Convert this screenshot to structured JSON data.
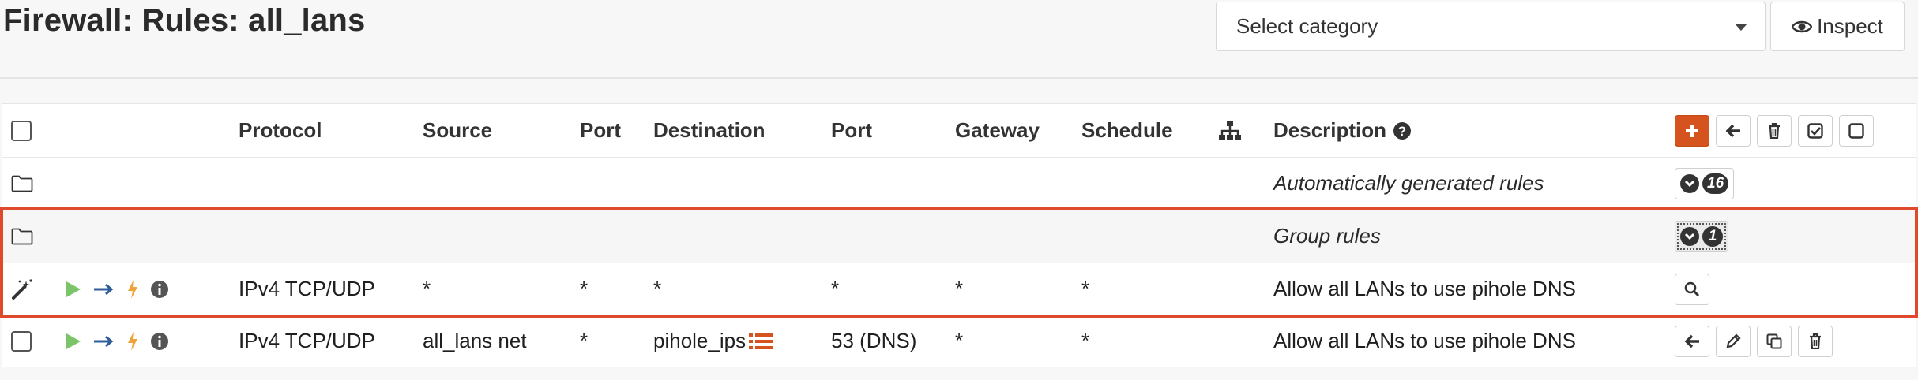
{
  "page": {
    "title": "Firewall: Rules: all_lans"
  },
  "toolbar": {
    "category_placeholder": "Select category",
    "inspect_label": "Inspect"
  },
  "table": {
    "headers": {
      "protocol": "Protocol",
      "source": "Source",
      "port": "Port",
      "destination": "Destination",
      "dest_port": "Port",
      "gateway": "Gateway",
      "schedule": "Schedule",
      "description": "Description"
    },
    "groups": [
      {
        "label": "Automatically generated rules",
        "count": "16"
      },
      {
        "label": "Group rules",
        "count": "1"
      }
    ],
    "rules": [
      {
        "protocol": "IPv4 TCP/UDP",
        "source": "*",
        "port": "*",
        "destination": "*",
        "dest_port": "*",
        "gateway": "*",
        "schedule": "*",
        "description": "Allow all LANs to use pihole DNS"
      },
      {
        "protocol": "IPv4 TCP/UDP",
        "source": "all_lans net",
        "port": "*",
        "destination": "pihole_ips",
        "dest_port": "53 (DNS)",
        "gateway": "*",
        "schedule": "*",
        "description": "Allow all LANs to use pihole DNS"
      }
    ]
  },
  "colors": {
    "accent": "#d4531f",
    "highlight": "#e04a2c",
    "play": "#7cc46a",
    "arrow": "#2f5d9a",
    "bolt": "#f0a23a"
  },
  "icons": [
    "eye-icon",
    "chevron-down-icon",
    "plus-icon",
    "arrow-left-icon",
    "trash-icon",
    "check-square-icon",
    "square-icon",
    "folder-icon",
    "sitemap-icon",
    "question-circle-icon",
    "magic-wand-icon",
    "play-icon",
    "arrow-right-icon",
    "bolt-icon",
    "info-circle-icon",
    "search-icon",
    "pencil-icon",
    "copy-icon",
    "list-icon"
  ]
}
